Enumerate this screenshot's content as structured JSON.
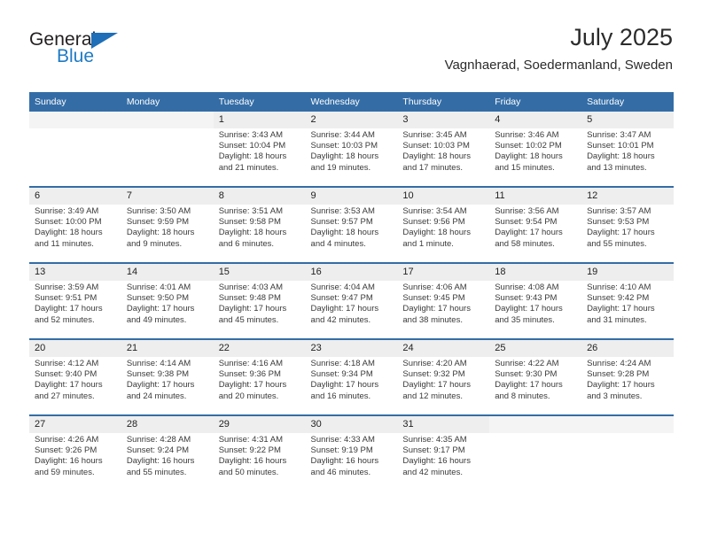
{
  "brand": {
    "name_part1": "General",
    "name_part2": "Blue",
    "accent_color": "#1e7bc4",
    "triangle_color": "#1e6fb8"
  },
  "header": {
    "title": "July 2025",
    "location": "Vagnhaerad, Soedermanland, Sweden"
  },
  "calendar": {
    "header_bg": "#346DA6",
    "daynum_bg": "#eeeeee",
    "weekday_headers": [
      "Sunday",
      "Monday",
      "Tuesday",
      "Wednesday",
      "Thursday",
      "Friday",
      "Saturday"
    ],
    "weeks": [
      [
        {
          "day": "",
          "lines": []
        },
        {
          "day": "",
          "lines": []
        },
        {
          "day": "1",
          "lines": [
            "Sunrise: 3:43 AM",
            "Sunset: 10:04 PM",
            "Daylight: 18 hours",
            "and 21 minutes."
          ]
        },
        {
          "day": "2",
          "lines": [
            "Sunrise: 3:44 AM",
            "Sunset: 10:03 PM",
            "Daylight: 18 hours",
            "and 19 minutes."
          ]
        },
        {
          "day": "3",
          "lines": [
            "Sunrise: 3:45 AM",
            "Sunset: 10:03 PM",
            "Daylight: 18 hours",
            "and 17 minutes."
          ]
        },
        {
          "day": "4",
          "lines": [
            "Sunrise: 3:46 AM",
            "Sunset: 10:02 PM",
            "Daylight: 18 hours",
            "and 15 minutes."
          ]
        },
        {
          "day": "5",
          "lines": [
            "Sunrise: 3:47 AM",
            "Sunset: 10:01 PM",
            "Daylight: 18 hours",
            "and 13 minutes."
          ]
        }
      ],
      [
        {
          "day": "6",
          "lines": [
            "Sunrise: 3:49 AM",
            "Sunset: 10:00 PM",
            "Daylight: 18 hours",
            "and 11 minutes."
          ]
        },
        {
          "day": "7",
          "lines": [
            "Sunrise: 3:50 AM",
            "Sunset: 9:59 PM",
            "Daylight: 18 hours",
            "and 9 minutes."
          ]
        },
        {
          "day": "8",
          "lines": [
            "Sunrise: 3:51 AM",
            "Sunset: 9:58 PM",
            "Daylight: 18 hours",
            "and 6 minutes."
          ]
        },
        {
          "day": "9",
          "lines": [
            "Sunrise: 3:53 AM",
            "Sunset: 9:57 PM",
            "Daylight: 18 hours",
            "and 4 minutes."
          ]
        },
        {
          "day": "10",
          "lines": [
            "Sunrise: 3:54 AM",
            "Sunset: 9:56 PM",
            "Daylight: 18 hours",
            "and 1 minute."
          ]
        },
        {
          "day": "11",
          "lines": [
            "Sunrise: 3:56 AM",
            "Sunset: 9:54 PM",
            "Daylight: 17 hours",
            "and 58 minutes."
          ]
        },
        {
          "day": "12",
          "lines": [
            "Sunrise: 3:57 AM",
            "Sunset: 9:53 PM",
            "Daylight: 17 hours",
            "and 55 minutes."
          ]
        }
      ],
      [
        {
          "day": "13",
          "lines": [
            "Sunrise: 3:59 AM",
            "Sunset: 9:51 PM",
            "Daylight: 17 hours",
            "and 52 minutes."
          ]
        },
        {
          "day": "14",
          "lines": [
            "Sunrise: 4:01 AM",
            "Sunset: 9:50 PM",
            "Daylight: 17 hours",
            "and 49 minutes."
          ]
        },
        {
          "day": "15",
          "lines": [
            "Sunrise: 4:03 AM",
            "Sunset: 9:48 PM",
            "Daylight: 17 hours",
            "and 45 minutes."
          ]
        },
        {
          "day": "16",
          "lines": [
            "Sunrise: 4:04 AM",
            "Sunset: 9:47 PM",
            "Daylight: 17 hours",
            "and 42 minutes."
          ]
        },
        {
          "day": "17",
          "lines": [
            "Sunrise: 4:06 AM",
            "Sunset: 9:45 PM",
            "Daylight: 17 hours",
            "and 38 minutes."
          ]
        },
        {
          "day": "18",
          "lines": [
            "Sunrise: 4:08 AM",
            "Sunset: 9:43 PM",
            "Daylight: 17 hours",
            "and 35 minutes."
          ]
        },
        {
          "day": "19",
          "lines": [
            "Sunrise: 4:10 AM",
            "Sunset: 9:42 PM",
            "Daylight: 17 hours",
            "and 31 minutes."
          ]
        }
      ],
      [
        {
          "day": "20",
          "lines": [
            "Sunrise: 4:12 AM",
            "Sunset: 9:40 PM",
            "Daylight: 17 hours",
            "and 27 minutes."
          ]
        },
        {
          "day": "21",
          "lines": [
            "Sunrise: 4:14 AM",
            "Sunset: 9:38 PM",
            "Daylight: 17 hours",
            "and 24 minutes."
          ]
        },
        {
          "day": "22",
          "lines": [
            "Sunrise: 4:16 AM",
            "Sunset: 9:36 PM",
            "Daylight: 17 hours",
            "and 20 minutes."
          ]
        },
        {
          "day": "23",
          "lines": [
            "Sunrise: 4:18 AM",
            "Sunset: 9:34 PM",
            "Daylight: 17 hours",
            "and 16 minutes."
          ]
        },
        {
          "day": "24",
          "lines": [
            "Sunrise: 4:20 AM",
            "Sunset: 9:32 PM",
            "Daylight: 17 hours",
            "and 12 minutes."
          ]
        },
        {
          "day": "25",
          "lines": [
            "Sunrise: 4:22 AM",
            "Sunset: 9:30 PM",
            "Daylight: 17 hours",
            "and 8 minutes."
          ]
        },
        {
          "day": "26",
          "lines": [
            "Sunrise: 4:24 AM",
            "Sunset: 9:28 PM",
            "Daylight: 17 hours",
            "and 3 minutes."
          ]
        }
      ],
      [
        {
          "day": "27",
          "lines": [
            "Sunrise: 4:26 AM",
            "Sunset: 9:26 PM",
            "Daylight: 16 hours",
            "and 59 minutes."
          ]
        },
        {
          "day": "28",
          "lines": [
            "Sunrise: 4:28 AM",
            "Sunset: 9:24 PM",
            "Daylight: 16 hours",
            "and 55 minutes."
          ]
        },
        {
          "day": "29",
          "lines": [
            "Sunrise: 4:31 AM",
            "Sunset: 9:22 PM",
            "Daylight: 16 hours",
            "and 50 minutes."
          ]
        },
        {
          "day": "30",
          "lines": [
            "Sunrise: 4:33 AM",
            "Sunset: 9:19 PM",
            "Daylight: 16 hours",
            "and 46 minutes."
          ]
        },
        {
          "day": "31",
          "lines": [
            "Sunrise: 4:35 AM",
            "Sunset: 9:17 PM",
            "Daylight: 16 hours",
            "and 42 minutes."
          ]
        },
        {
          "day": "",
          "lines": []
        },
        {
          "day": "",
          "lines": []
        }
      ]
    ]
  }
}
